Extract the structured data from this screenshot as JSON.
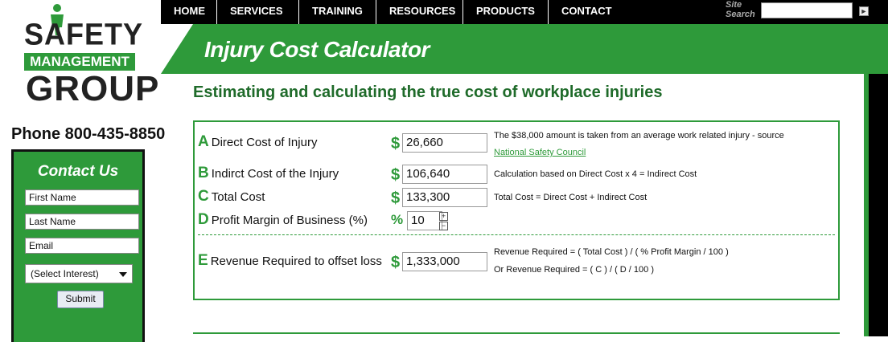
{
  "brand": {
    "logo_line1": "SAFETY",
    "logo_line2": "MANAGEMENT",
    "logo_line3": "GROUP",
    "phone": "Phone 800-435-8850",
    "accent_color": "#2e9a3a"
  },
  "nav": {
    "items": [
      "HOME",
      "SERVICES",
      "TRAINING",
      "RESOURCES",
      "PRODUCTS",
      "CONTACT"
    ],
    "search_label_line1": "Site",
    "search_label_line2": "Search",
    "search_value": "",
    "search_go_icon": "arrow-right-icon"
  },
  "banner": {
    "title": "Injury Cost Calculator"
  },
  "page": {
    "subtitle": "Estimating and calculating the true cost of workplace injuries"
  },
  "contact": {
    "title": "Contact Us",
    "first_name": "First Name",
    "last_name": "Last Name",
    "email": "Email",
    "interest": "(Select Interest)",
    "submit": "Submit"
  },
  "calculator": {
    "rows": [
      {
        "letter": "A",
        "label": "Direct Cost of Injury",
        "symbol": "$",
        "value": "26,660",
        "note": "The $38,000 amount is taken from an average work related injury - source",
        "link": "National Safety Council"
      },
      {
        "letter": "B",
        "label": "Indirct Cost of the Injury",
        "symbol": "$",
        "value": "106,640",
        "note": "Calculation based on Direct Cost x 4 = Indirect Cost"
      },
      {
        "letter": "C",
        "label": "Total Cost",
        "symbol": "$",
        "value": "133,300",
        "note": "Total Cost = Direct Cost + Indirect Cost"
      },
      {
        "letter": "D",
        "label": "Profit Margin of Business (%)",
        "symbol": "%",
        "value": "10"
      },
      {
        "letter": "E",
        "label": "Revenue Required to offset loss",
        "symbol": "$",
        "value": "1,333,000",
        "note": "Revenue Required = ( Total Cost ) / ( % Profit Margin / 100 )",
        "note2": "Or Revenue Required = ( C ) / ( D / 100 )"
      }
    ]
  }
}
